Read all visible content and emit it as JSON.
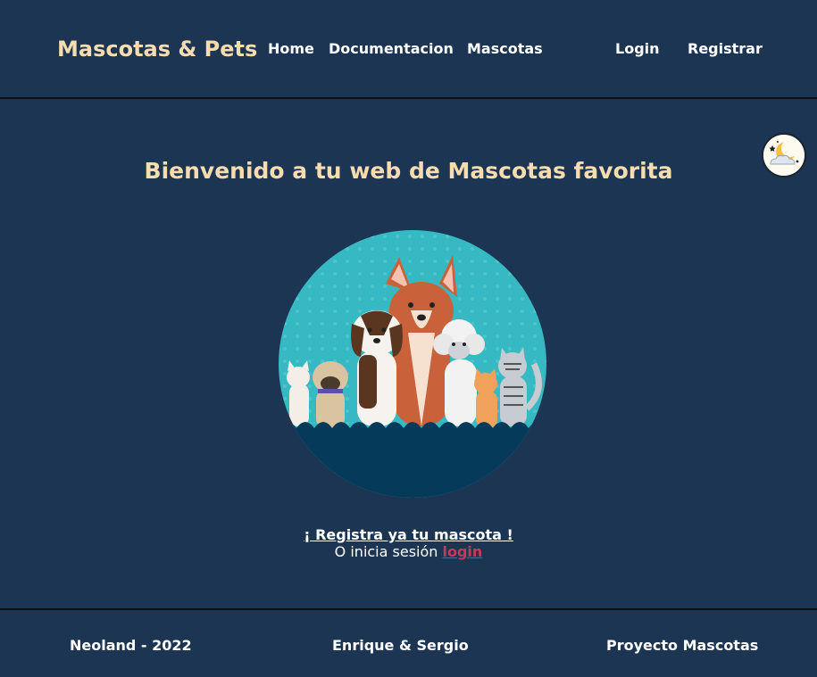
{
  "header": {
    "brand": "Mascotas & Pets",
    "nav": {
      "home": "Home",
      "documentation": "Documentacion",
      "pets": "Mascotas",
      "login": "Login",
      "register": "Registrar"
    }
  },
  "theme_toggle": {
    "icon": "moon-cloud-icon"
  },
  "main": {
    "welcome": "Bienvenido a tu web de Mascotas favorita",
    "hero_image": "pets-group-illustration",
    "cta_register": "¡ Registra ya tu mascota !",
    "cta_or_login_prefix": "O inicia sesión",
    "cta_login": "login"
  },
  "footer": {
    "left": "Neoland - 2022",
    "center": "Enrique & Sergio",
    "right": "Proyecto Mascotas"
  },
  "colors": {
    "background": "#1b3553",
    "brand_text": "#f6dcae",
    "login_link": "#c23b5a",
    "divider": "#0b0f14"
  }
}
